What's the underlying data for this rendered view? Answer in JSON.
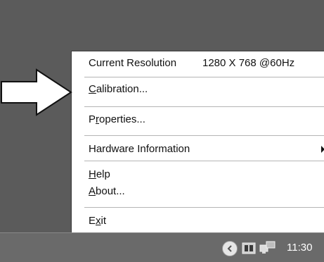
{
  "menu": {
    "current_resolution_label": "Current Resolution",
    "current_resolution_value": "1280 X 768 @60Hz",
    "calibration": {
      "mnemonic": "C",
      "rest": "alibration..."
    },
    "properties": {
      "pre": "P",
      "mnemonic": "r",
      "rest": "operties..."
    },
    "hardware_information": "Hardware Information",
    "help": {
      "mnemonic": "H",
      "rest": "elp"
    },
    "about": {
      "mnemonic": "A",
      "rest": "bout..."
    },
    "exit": {
      "pre": "E",
      "mnemonic": "x",
      "rest": "it"
    }
  },
  "taskbar": {
    "clock": "11:30",
    "tray_icons": [
      "chevron-left-icon",
      "display-settings-icon",
      "network-icon"
    ]
  },
  "annotation": {
    "pointer_arrow": "right-arrow-icon"
  },
  "colors": {
    "desktop": "#5b5b5b",
    "taskbar": "#6a6a6a",
    "menu_bg": "#ffffff"
  }
}
